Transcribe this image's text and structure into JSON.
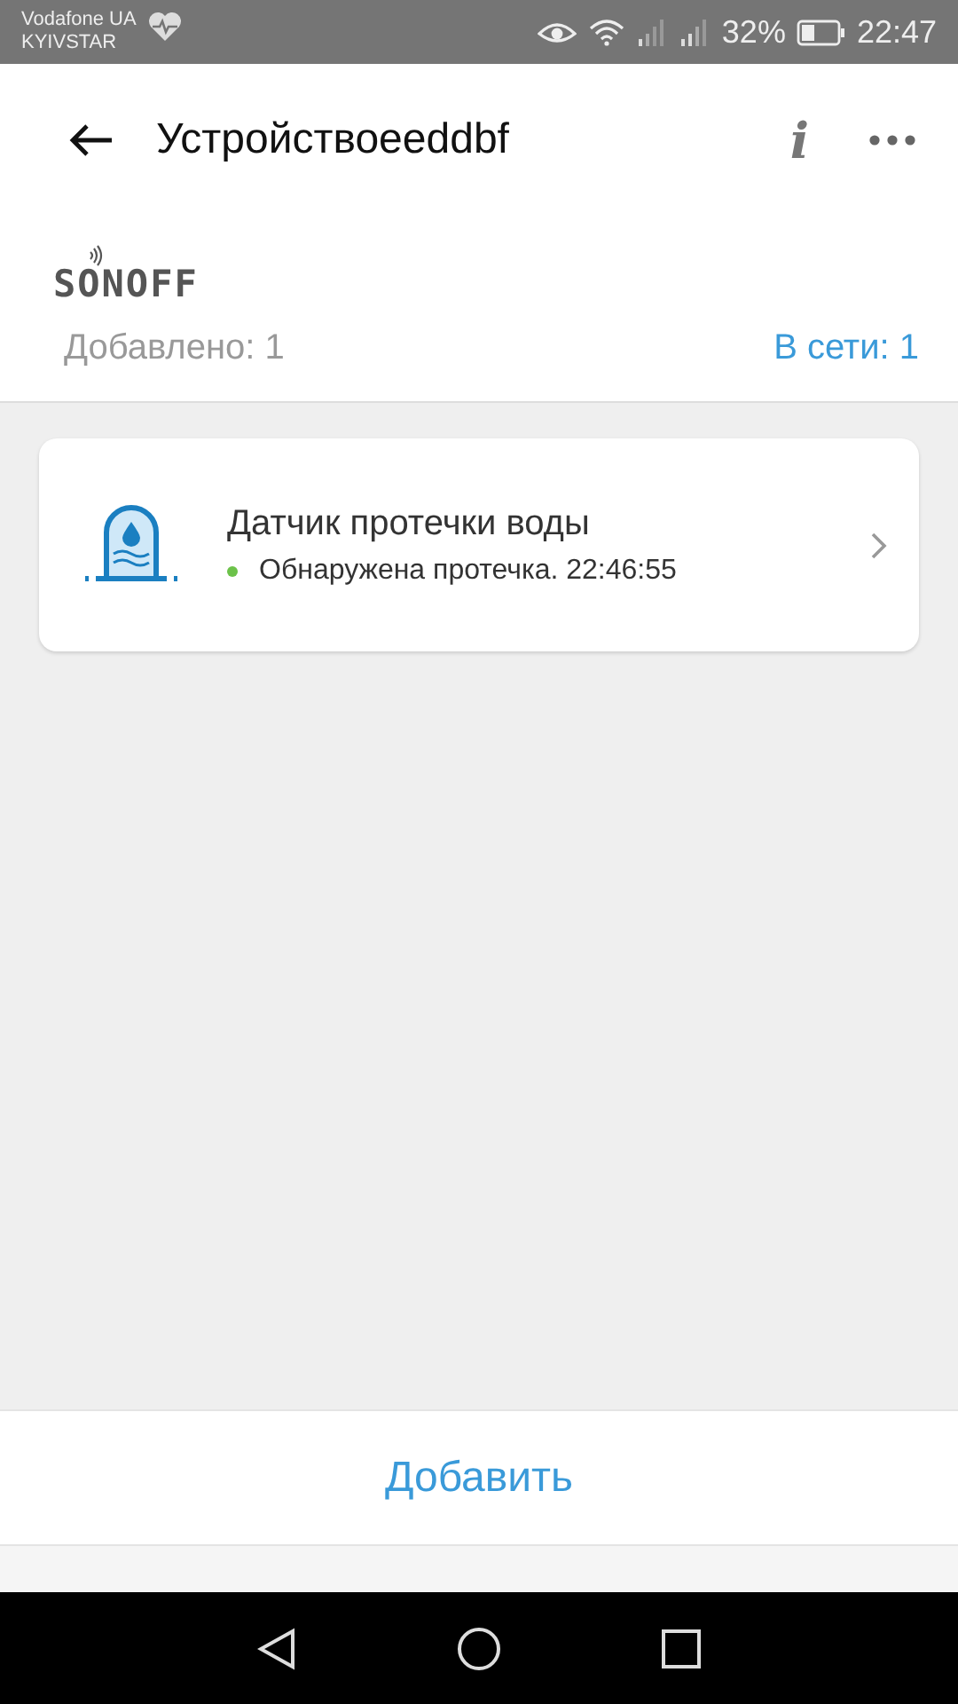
{
  "status_bar": {
    "carrier": "Vodafone UA",
    "carrier_2": "KYIVSTAR",
    "battery": "32%",
    "time": "22:47"
  },
  "header": {
    "title": "Устройствоeeddbf",
    "info_icon": "i"
  },
  "brand": {
    "logo": "SONOFF"
  },
  "counts": {
    "added": "Добавлено: 1",
    "online": "В сети: 1"
  },
  "devices": [
    {
      "name": "Датчик протечки воды",
      "status": "Обнаружена протечка. 22:46:55",
      "online": true
    }
  ],
  "add_button": "Добавить"
}
